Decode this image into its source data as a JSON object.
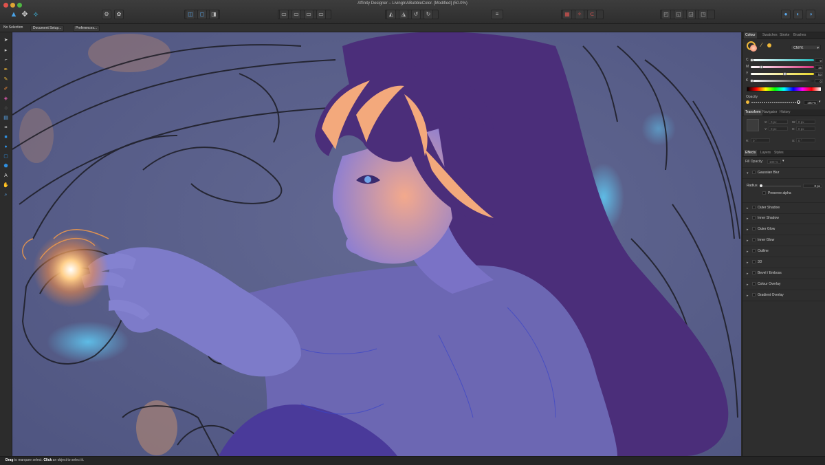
{
  "window": {
    "title": "Affinity Designer – LivingInABubbleColor. [Modified] (50.0%)"
  },
  "toolbar": {
    "personas": [
      "designer-persona-icon",
      "pixel-persona-icon",
      "export-persona-icon"
    ],
    "accent": "#4aa3e8"
  },
  "context_toolbar": {
    "selection": "No Selection",
    "document_setup": "Document Setup...",
    "preferences": "Preferences..."
  },
  "tools": [
    "move-icon",
    "node-icon",
    "pen-icon",
    "pencil-icon",
    "vector-brush-icon",
    "fill-icon",
    "transparency-icon",
    "gradient-icon",
    "crop-icon",
    "rectangle-icon",
    "ellipse-icon",
    "rounded-rect-icon",
    "shape-icon",
    "text-icon",
    "hand-icon",
    "zoom-icon"
  ],
  "colour_panel": {
    "tabs": [
      "Colour",
      "Swatches",
      "Stroke",
      "Brushes"
    ],
    "active_tab": "Colour",
    "model": "CMYK",
    "sliders": [
      {
        "label": "C",
        "value": "0",
        "fraction": 0.0,
        "color": "#21b5b8"
      },
      {
        "label": "M",
        "value": "16",
        "fraction": 0.16,
        "color": "#d33a7a"
      },
      {
        "label": "Y",
        "value": "53",
        "fraction": 0.53,
        "color": "#e6d52a"
      },
      {
        "label": "K",
        "value": "0",
        "fraction": 0.0,
        "color": "#8a8a8a"
      }
    ],
    "opacity_label": "Opacity",
    "opacity_value": "100 %",
    "fill_color": "#f7b08a",
    "stroke_color": "#f0b93a"
  },
  "transform_panel": {
    "tabs": [
      "Transform",
      "Navigator",
      "History"
    ],
    "active_tab": "Transform",
    "fields": [
      {
        "label": "X:",
        "value": "0 px"
      },
      {
        "label": "W:",
        "value": "0 px"
      },
      {
        "label": "Y:",
        "value": "0 px"
      },
      {
        "label": "H:",
        "value": "0 px"
      },
      {
        "label": "R:",
        "value": "0 °"
      },
      {
        "label": "S:",
        "value": "0 °"
      }
    ]
  },
  "effects_panel": {
    "tabs": [
      "Effects",
      "Layers",
      "Styles"
    ],
    "active_tab": "Effects",
    "fill_opacity_label": "Fill Opacity:",
    "fill_opacity_value": "100 %",
    "expanded_effect": "Gaussian Blur",
    "radius_label": "Radius",
    "radius_value": "0 px",
    "preserve_alpha": "Preserve alpha",
    "effects": [
      "Outer Shadow",
      "Inner Shadow",
      "Outer Glow",
      "Inner Glow",
      "Outline",
      "3D",
      "Bevel / Emboss",
      "Colour Overlay",
      "Gradient Overlay"
    ]
  },
  "status": {
    "bold1": "Drag",
    "text1": " to marquee select. ",
    "bold2": "Click",
    "text2": " an object to select it."
  }
}
